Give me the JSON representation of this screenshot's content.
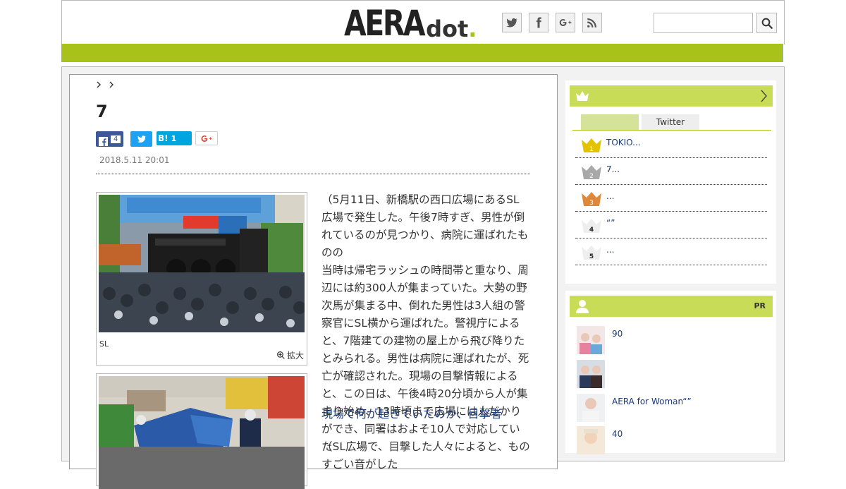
{
  "header": {
    "logo_main": "AERA",
    "logo_sub": "dot",
    "logo_period": ".",
    "social_icons": [
      "twitter-icon",
      "facebook-icon",
      "google-plus-icon",
      "rss-icon"
    ],
    "search_placeholder": ""
  },
  "article": {
    "breadcrumb": [
      ">",
      ">"
    ],
    "title": "7",
    "share": {
      "facebook_count": "4",
      "hatena_label": "B!",
      "hatena_count": "1"
    },
    "date": "2018.5.11 20:01",
    "photo1_caption": "SL",
    "zoom_label": "拡大",
    "paragraph1": "（5月11日、新橋駅の西口広場にあるSL広場で発生した。午後7時すぎ、男性が倒れているのが見つかり、病院に運ばれたものの",
    "paragraph2": "当時は帰宅ラッシュの時間帯と重なり、周辺には約300人が集まっていた。大勢の野次馬が集まる中、倒れた男性は3人組の警察官にSL横から運ばれた。警視庁によると、7階建ての建物の屋上から飛び降りたとみられる。男性は病院に運ばれたが、死亡が確認された。現場の目撃情報によると、この日は、午後4時20分頃から人が集まり始め、13時頃まで広場には人だかりができ、同署はおよそ10人で対応していた",
    "subheading": "現場で何が起きていたのか、目撃者",
    "paragraph3": "（SL広場で、目撃した人々によると、ものすごい音がした"
  },
  "sidebar": {
    "ranking": {
      "tabs": [
        "",
        "Twitter"
      ],
      "items": [
        {
          "rank": "1",
          "text": "TOKIO..."
        },
        {
          "rank": "2",
          "text": "7..."
        },
        {
          "rank": "3",
          "text": "..."
        },
        {
          "rank": "4",
          "text": "“”"
        },
        {
          "rank": "5",
          "text": "..."
        }
      ]
    },
    "pr": {
      "label": "PR",
      "items": [
        {
          "text": "90"
        },
        {
          "text": ""
        },
        {
          "text": "AERA for Woman“”"
        },
        {
          "text": "40"
        }
      ]
    }
  },
  "colors": {
    "brand_green": "#a9c21a",
    "panel_green": "#c8dc57",
    "link_blue": "#1a3a78",
    "facebook": "#3b5998",
    "twitter": "#1da1f2",
    "hatena": "#00a4de",
    "gold": "#e3c200",
    "silver": "#a8a8a8",
    "bronze": "#e0883a"
  }
}
